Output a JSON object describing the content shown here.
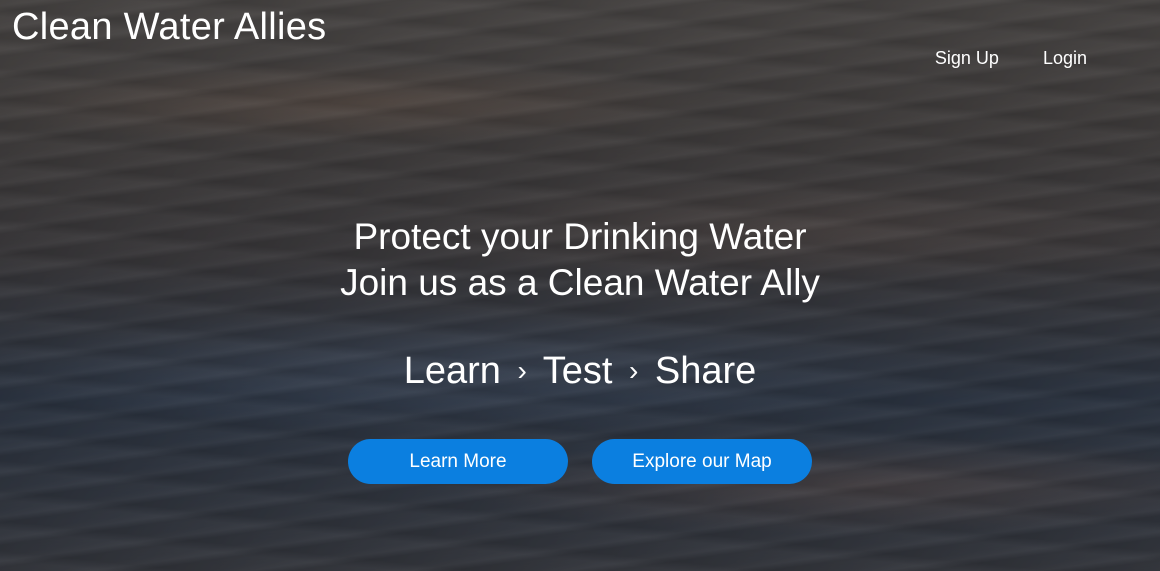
{
  "brand": {
    "title": "Clean Water Allies"
  },
  "nav": {
    "signup_label": "Sign Up",
    "login_label": "Login"
  },
  "hero": {
    "headline_line1": "Protect your Drinking Water",
    "headline_line2": "Join us as a Clean Water Ally",
    "steps": [
      "Learn",
      "Test",
      "Share"
    ],
    "step_separator": "›"
  },
  "buttons": {
    "learn_more_label": "Learn More",
    "explore_map_label": "Explore our Map"
  },
  "colors": {
    "button_blue": "#0b7fe0",
    "text": "#ffffff"
  }
}
